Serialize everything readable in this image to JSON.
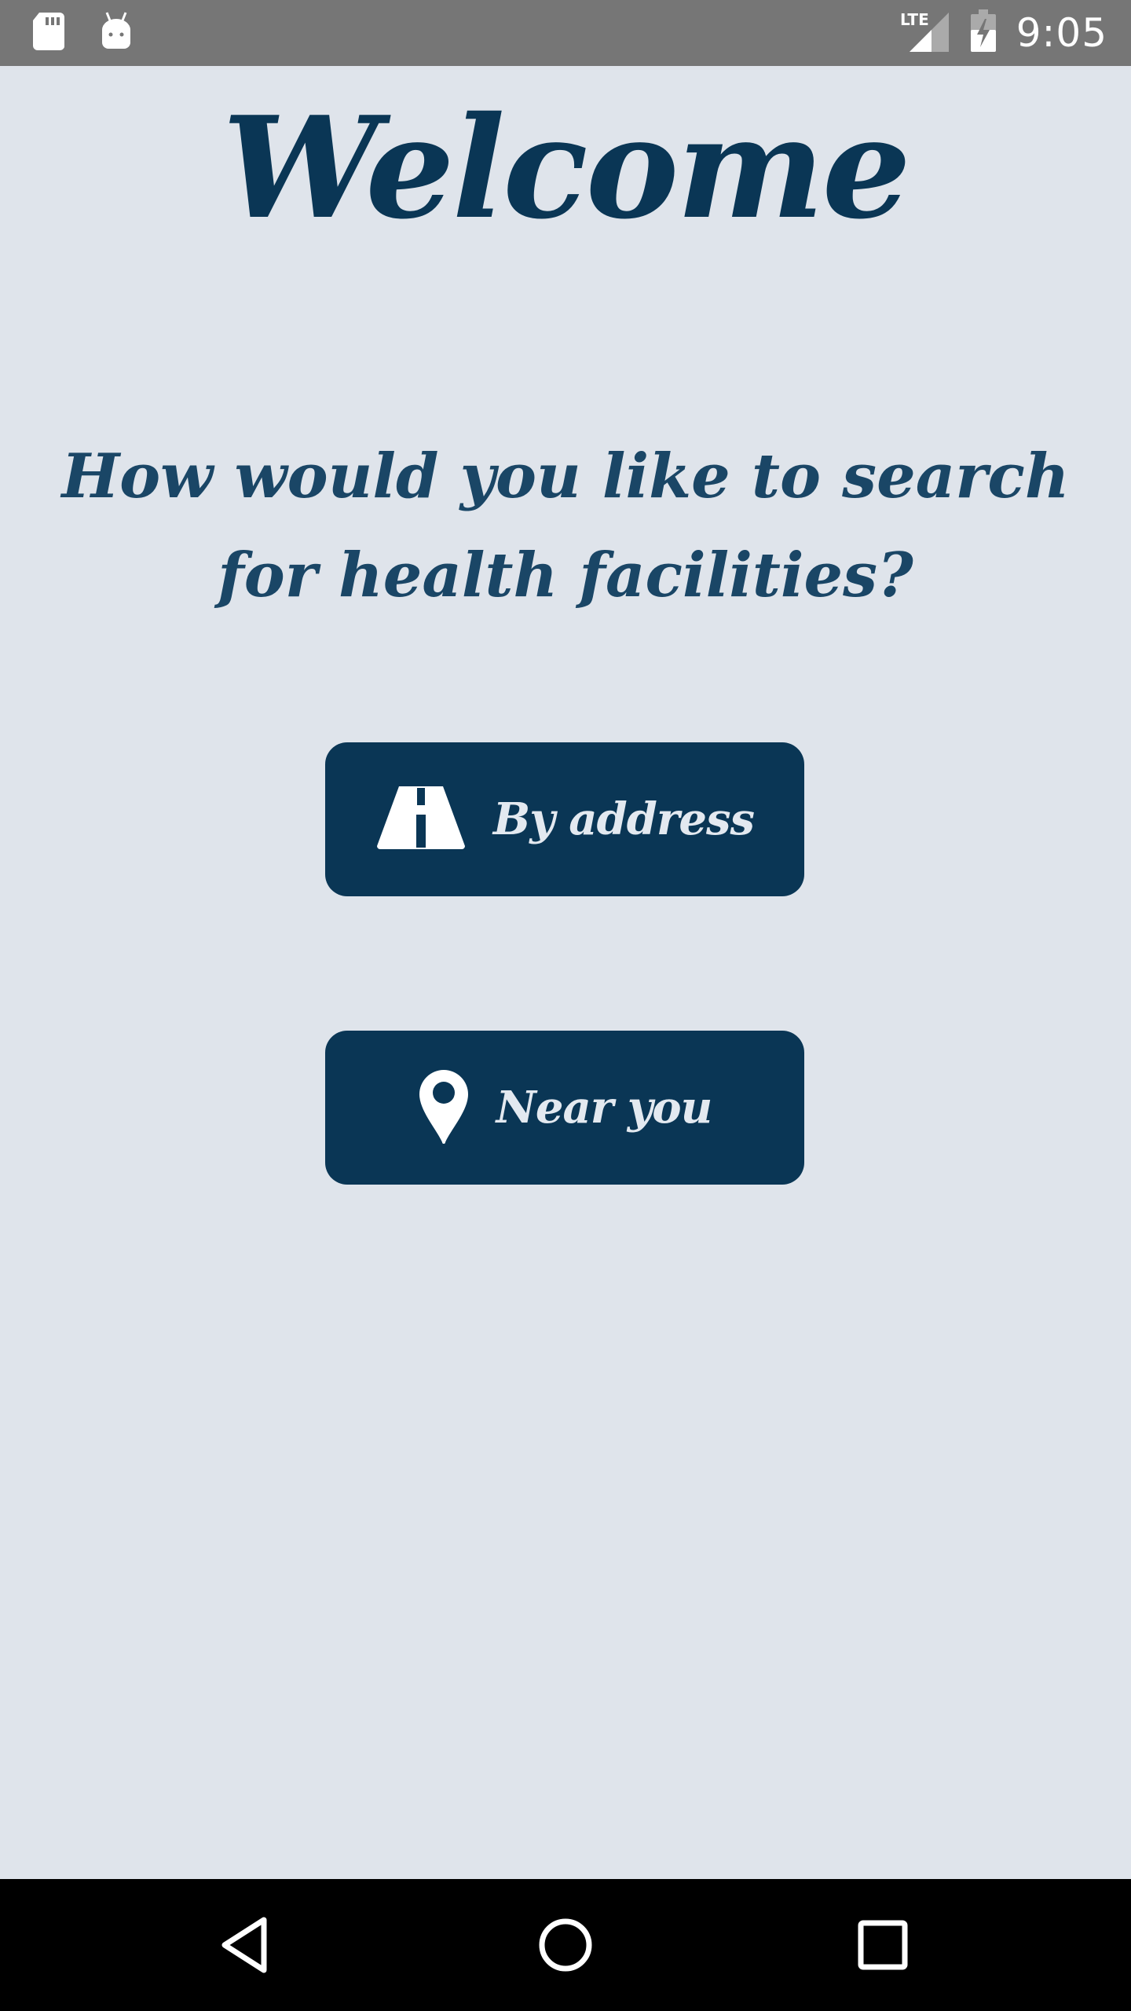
{
  "status_bar": {
    "time": "9:05",
    "network": "LTE",
    "icons": [
      "sd-card-icon",
      "android-icon",
      "lte-signal-icon",
      "battery-charging-icon"
    ]
  },
  "main": {
    "title": "Welcome",
    "question": "How would you like to search for health facilities?",
    "buttons": [
      {
        "label": "By address",
        "icon": "road-icon"
      },
      {
        "label": "Near you",
        "icon": "map-pin-icon"
      }
    ]
  },
  "nav_bar": {
    "icons": [
      "back-icon",
      "home-icon",
      "recents-icon"
    ]
  },
  "colors": {
    "background": "#dfe4eb",
    "primary": "#0a3655",
    "question_text": "#1a4666",
    "button_text": "#e3e9f0",
    "status_bar": "#767676",
    "nav_bar": "#000000"
  }
}
